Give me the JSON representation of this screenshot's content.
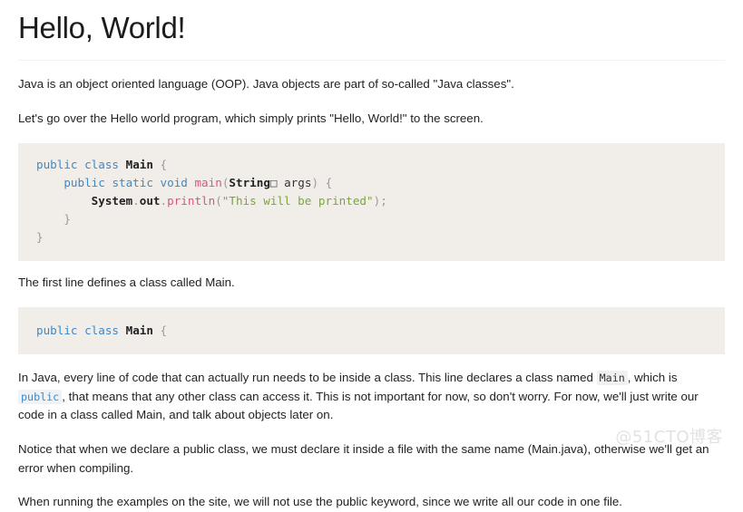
{
  "page": {
    "title": "Hello, World!"
  },
  "paragraphs": {
    "intro1": "Java is an object oriented language (OOP). Java objects are part of so-called \"Java classes\".",
    "intro2": "Let's go over the Hello world program, which simply prints \"Hello, World!\" to the screen.",
    "after_main_code": "The first line defines a class called Main.",
    "explain_a": "In Java, every line of code that can actually run needs to be inside a class. This line declares a class named ",
    "explain_b": ", which is ",
    "explain_c": ", that means that any other class can access it. This is not important for now, so don't worry. For now, we'll just write our code in a class called Main, and talk about objects later on.",
    "notice": "Notice that when we declare a public class, we must declare it inside a file with the same name (Main.java), otherwise we'll get an error when compiling.",
    "running": "When running the examples on the site, we will not use the public keyword, since we write all our code in one file."
  },
  "inline_code": {
    "main": "Main",
    "public": "public"
  },
  "code_main": {
    "line1": {
      "kw_public": "public",
      "kw_class": "class",
      "type_main": "Main",
      "brace_open": "{"
    },
    "line2": {
      "indent": "    ",
      "kw_public": "public",
      "kw_static": "static",
      "kw_void": "void",
      "fn_main": "main",
      "paren_open": "(",
      "type_string": "String",
      "brackets": "□",
      "arg": "args",
      "paren_close": ")",
      "brace_open": "{"
    },
    "line3": {
      "indent": "        ",
      "obj_system": "System",
      "dot1": ".",
      "obj_out": "out",
      "dot2": ".",
      "fn_println": "println",
      "paren_open": "(",
      "string": "\"This will be printed\"",
      "paren_close": ")",
      "semicolon": ";"
    },
    "line4": {
      "indent": "    ",
      "brace_close": "}"
    },
    "line5": {
      "brace_close": "}"
    }
  },
  "code_class_only": {
    "kw_public": "public",
    "kw_class": "class",
    "type_main": "Main",
    "brace_open": "{"
  },
  "watermark": {
    "text": "@51CTO博客"
  },
  "colors": {
    "keyword": "#3f87c7",
    "function": "#e0527e",
    "string": "#79a63c",
    "type": "#222222",
    "punctuation": "#9a9a9a",
    "code_background": "#f1eeea",
    "page_background": "#ffffff",
    "text": "#222222"
  }
}
